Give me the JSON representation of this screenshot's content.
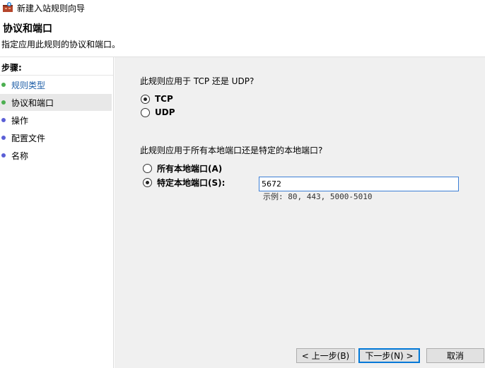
{
  "window": {
    "title": "新建入站规则向导",
    "page_title": "协议和端口",
    "page_subtitle": "指定应用此规则的协议和端口。"
  },
  "sidebar": {
    "steps_title": "步骤:",
    "items": [
      {
        "label": "规则类型",
        "state": "done",
        "dot_color": "#4caf50"
      },
      {
        "label": "协议和端口",
        "state": "active",
        "dot_color": "#4caf50"
      },
      {
        "label": "操作",
        "state": "pending",
        "dot_color": "#5b5fd6"
      },
      {
        "label": "配置文件",
        "state": "pending",
        "dot_color": "#5b5fd6"
      },
      {
        "label": "名称",
        "state": "pending",
        "dot_color": "#5b5fd6"
      }
    ]
  },
  "protocol": {
    "question": "此规则应用于 TCP 还是 UDP?",
    "options": [
      {
        "label": "TCP",
        "checked": true
      },
      {
        "label": "UDP",
        "checked": false
      }
    ]
  },
  "ports": {
    "question": "此规则应用于所有本地端口还是特定的本地端口?",
    "options": [
      {
        "label": "所有本地端口(A)",
        "checked": false
      },
      {
        "label": "特定本地端口(S):",
        "checked": true
      }
    ],
    "value": "5672",
    "example": "示例: 80, 443, 5000-5010"
  },
  "buttons": {
    "back": "< 上一步(B)",
    "next": "下一步(N) >",
    "cancel": "取消"
  }
}
